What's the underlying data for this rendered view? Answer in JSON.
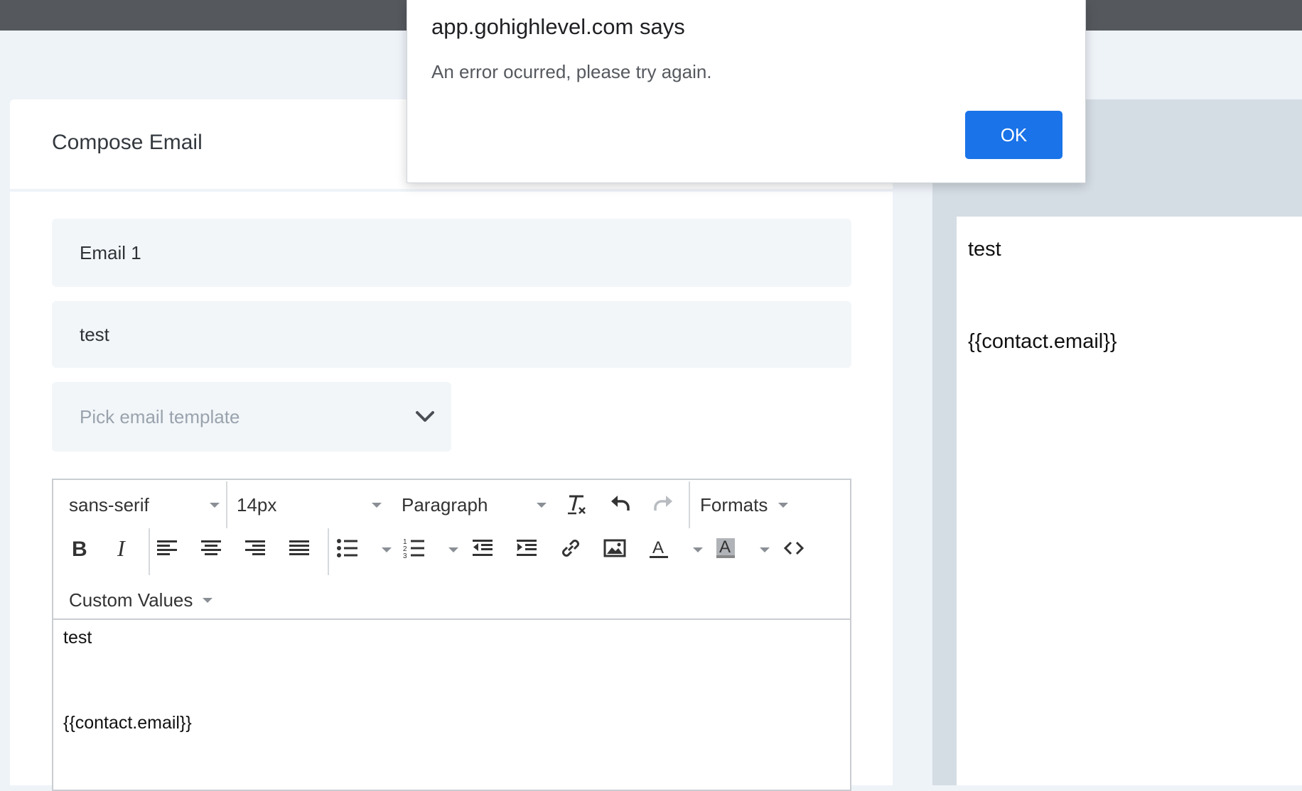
{
  "dialog": {
    "title": "app.gohighlevel.com says",
    "message": "An error ocurred, please try again.",
    "ok_label": "OK"
  },
  "compose": {
    "title": "Compose Email",
    "name_value": "Email 1",
    "subject_value": "test",
    "template_placeholder": "Pick email template"
  },
  "editor": {
    "font_family": "sans-serif",
    "font_size": "14px",
    "block_format": "Paragraph",
    "formats_label": "Formats",
    "custom_values_label": "Custom Values",
    "content": [
      "test",
      "{{contact.email}}"
    ]
  },
  "preview": {
    "lines": [
      "test",
      "{{contact.email}}"
    ]
  },
  "colors": {
    "accent": "#1a73e8",
    "topbar": "#55595e",
    "page_bg": "#eef3f8",
    "field_bg": "#f2f6f9",
    "preview_bg": "#d4dce4"
  }
}
